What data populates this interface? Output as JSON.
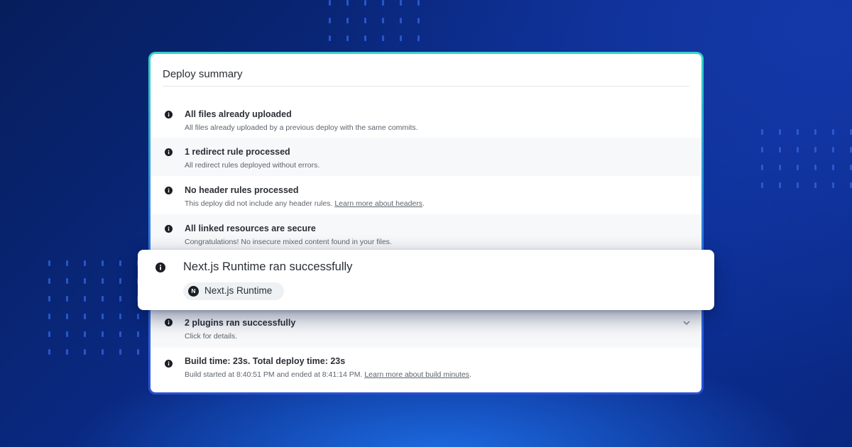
{
  "colors": {
    "background": "#0a2a86",
    "card_border_top": "#34d3c7",
    "card_border_bottom": "#2a4fd6",
    "icon": "#1b1e23"
  },
  "summary": {
    "title": "Deploy summary",
    "items": [
      {
        "icon": "info-icon",
        "title": "All files already uploaded",
        "subtitle": "All files already uploaded by a previous deploy with the same commits."
      },
      {
        "icon": "info-icon",
        "title": "1 redirect rule processed",
        "subtitle": "All redirect rules deployed without errors."
      },
      {
        "icon": "info-icon",
        "title": "No header rules processed",
        "subtitle": "This deploy did not include any header rules.",
        "link": "Learn more about headers",
        "suffix": "."
      },
      {
        "icon": "info-icon",
        "title": "All linked resources are secure",
        "subtitle": "Congratulations! No insecure mixed content found in your files."
      },
      {
        "icon": "info-icon",
        "title": "2 plugins ran successfully",
        "subtitle": "Click for details.",
        "expand_icon": "chevron-down-icon"
      },
      {
        "icon": "info-icon",
        "title": "Build time: 23s. Total deploy time: 23s",
        "subtitle": "Build started at 8:40:51 PM and ended at 8:41:14 PM.",
        "link": "Learn more about build minutes",
        "suffix": "."
      }
    ]
  },
  "highlight": {
    "icon": "info-icon",
    "title": "Next.js Runtime ran successfully",
    "plugin": {
      "logo": "N",
      "label": "Next.js Runtime"
    }
  }
}
